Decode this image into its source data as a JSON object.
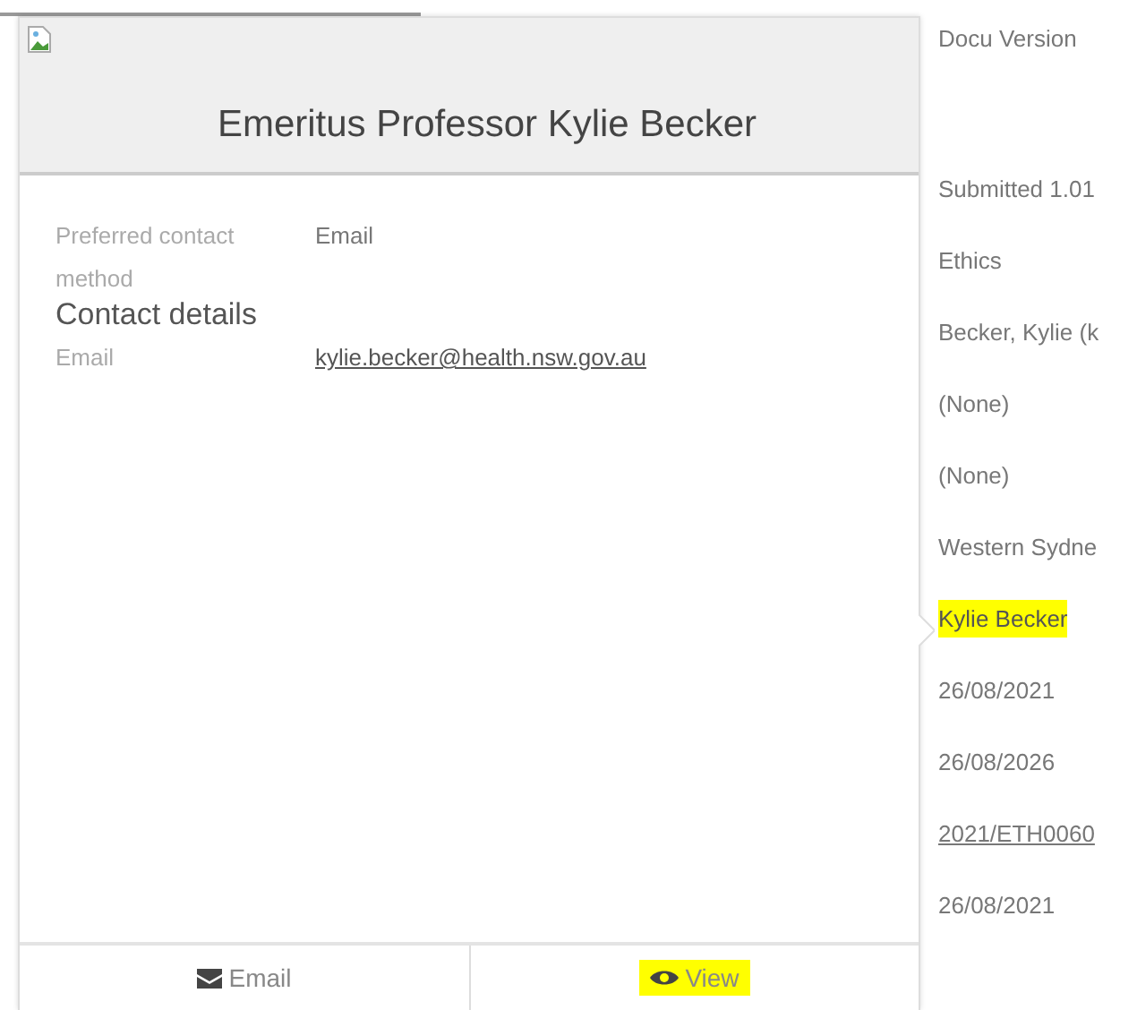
{
  "card": {
    "title": "Emeritus Professor Kylie Becker",
    "fields": [
      {
        "kind": "text",
        "label": "Preferred contact method",
        "value": "Email"
      },
      {
        "kind": "heading",
        "label": "Contact details"
      },
      {
        "kind": "link",
        "label": "Email",
        "value": "kylie.becker@health.nsw.gov.au"
      }
    ],
    "actions": [
      {
        "label": "Email",
        "highlighted": false
      },
      {
        "label": "View",
        "highlighted": true
      }
    ]
  },
  "details": [
    {
      "kind": "caption",
      "text": "Docu Version",
      "highlighted": false
    },
    {
      "kind": "text",
      "text": "Submitted 1.01",
      "highlighted": false
    },
    {
      "kind": "text",
      "text": "Ethics",
      "highlighted": false
    },
    {
      "kind": "text",
      "text": "Becker, Kylie (k",
      "highlighted": false
    },
    {
      "kind": "text",
      "text": "(None)",
      "highlighted": false
    },
    {
      "kind": "text",
      "text": "(None)",
      "highlighted": false
    },
    {
      "kind": "text",
      "text": "Western Sydne",
      "highlighted": false
    },
    {
      "kind": "text",
      "text": "Kylie Becker",
      "highlighted": true
    },
    {
      "kind": "text",
      "text": "26/08/2021",
      "highlighted": false
    },
    {
      "kind": "text",
      "text": "26/08/2026",
      "highlighted": false
    },
    {
      "kind": "link",
      "text": "2021/ETH0060",
      "highlighted": false
    },
    {
      "kind": "text",
      "text": "26/08/2021",
      "highlighted": false
    }
  ]
}
